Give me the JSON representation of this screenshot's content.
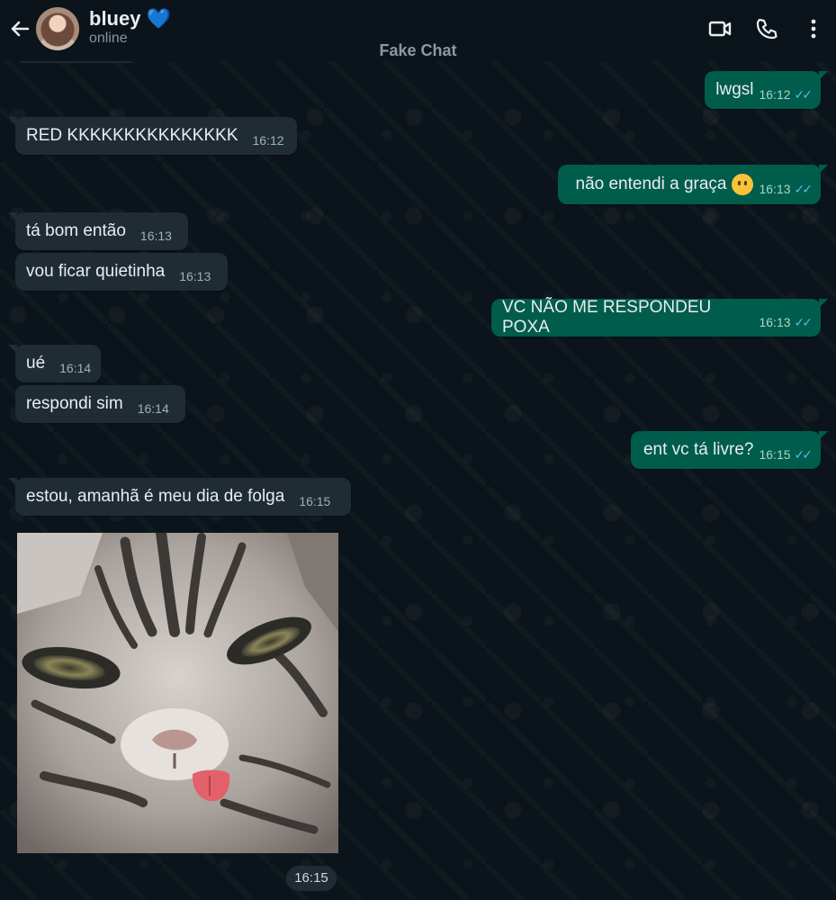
{
  "app": {
    "title": "Fake Chat"
  },
  "contact": {
    "name": "bluey",
    "name_emoji": "💙",
    "status": "online"
  },
  "header_icons": [
    "back-arrow-icon",
    "video-call-icon",
    "phone-call-icon",
    "more-options-icon"
  ],
  "colors": {
    "background": "#0b141a",
    "incoming_bubble": "#202c33",
    "outgoing_bubble": "#005c4b",
    "read_ticks": "#53bdeb"
  },
  "messages": [
    {
      "direction": "outgoing",
      "text": "lwgsl",
      "time": "16:12",
      "status": "read"
    },
    {
      "direction": "incoming",
      "text": "RED KKKKKKKKKKKKKKK",
      "time": "16:12"
    },
    {
      "direction": "outgoing",
      "text": "não entendi a graça",
      "emoji": "😶",
      "time": "16:13",
      "status": "read"
    },
    {
      "direction": "incoming",
      "text": "tá bom então",
      "time": "16:13"
    },
    {
      "direction": "incoming",
      "text": "vou ficar quietinha",
      "time": "16:13"
    },
    {
      "direction": "outgoing",
      "text": "VC NÃO ME RESPONDEU POXA",
      "time": "16:13",
      "status": "read"
    },
    {
      "direction": "incoming",
      "text": "ué",
      "time": "16:14"
    },
    {
      "direction": "incoming",
      "text": "respondi sim",
      "time": "16:14"
    },
    {
      "direction": "outgoing",
      "text": "ent vc tá livre?",
      "time": "16:15",
      "status": "read"
    },
    {
      "direction": "incoming",
      "text": "estou, amanhã é meu dia de folga",
      "time": "16:15"
    },
    {
      "direction": "incoming",
      "type": "image",
      "image": "tabby-kitten-tongue-out-photo",
      "time": "16:15"
    }
  ]
}
